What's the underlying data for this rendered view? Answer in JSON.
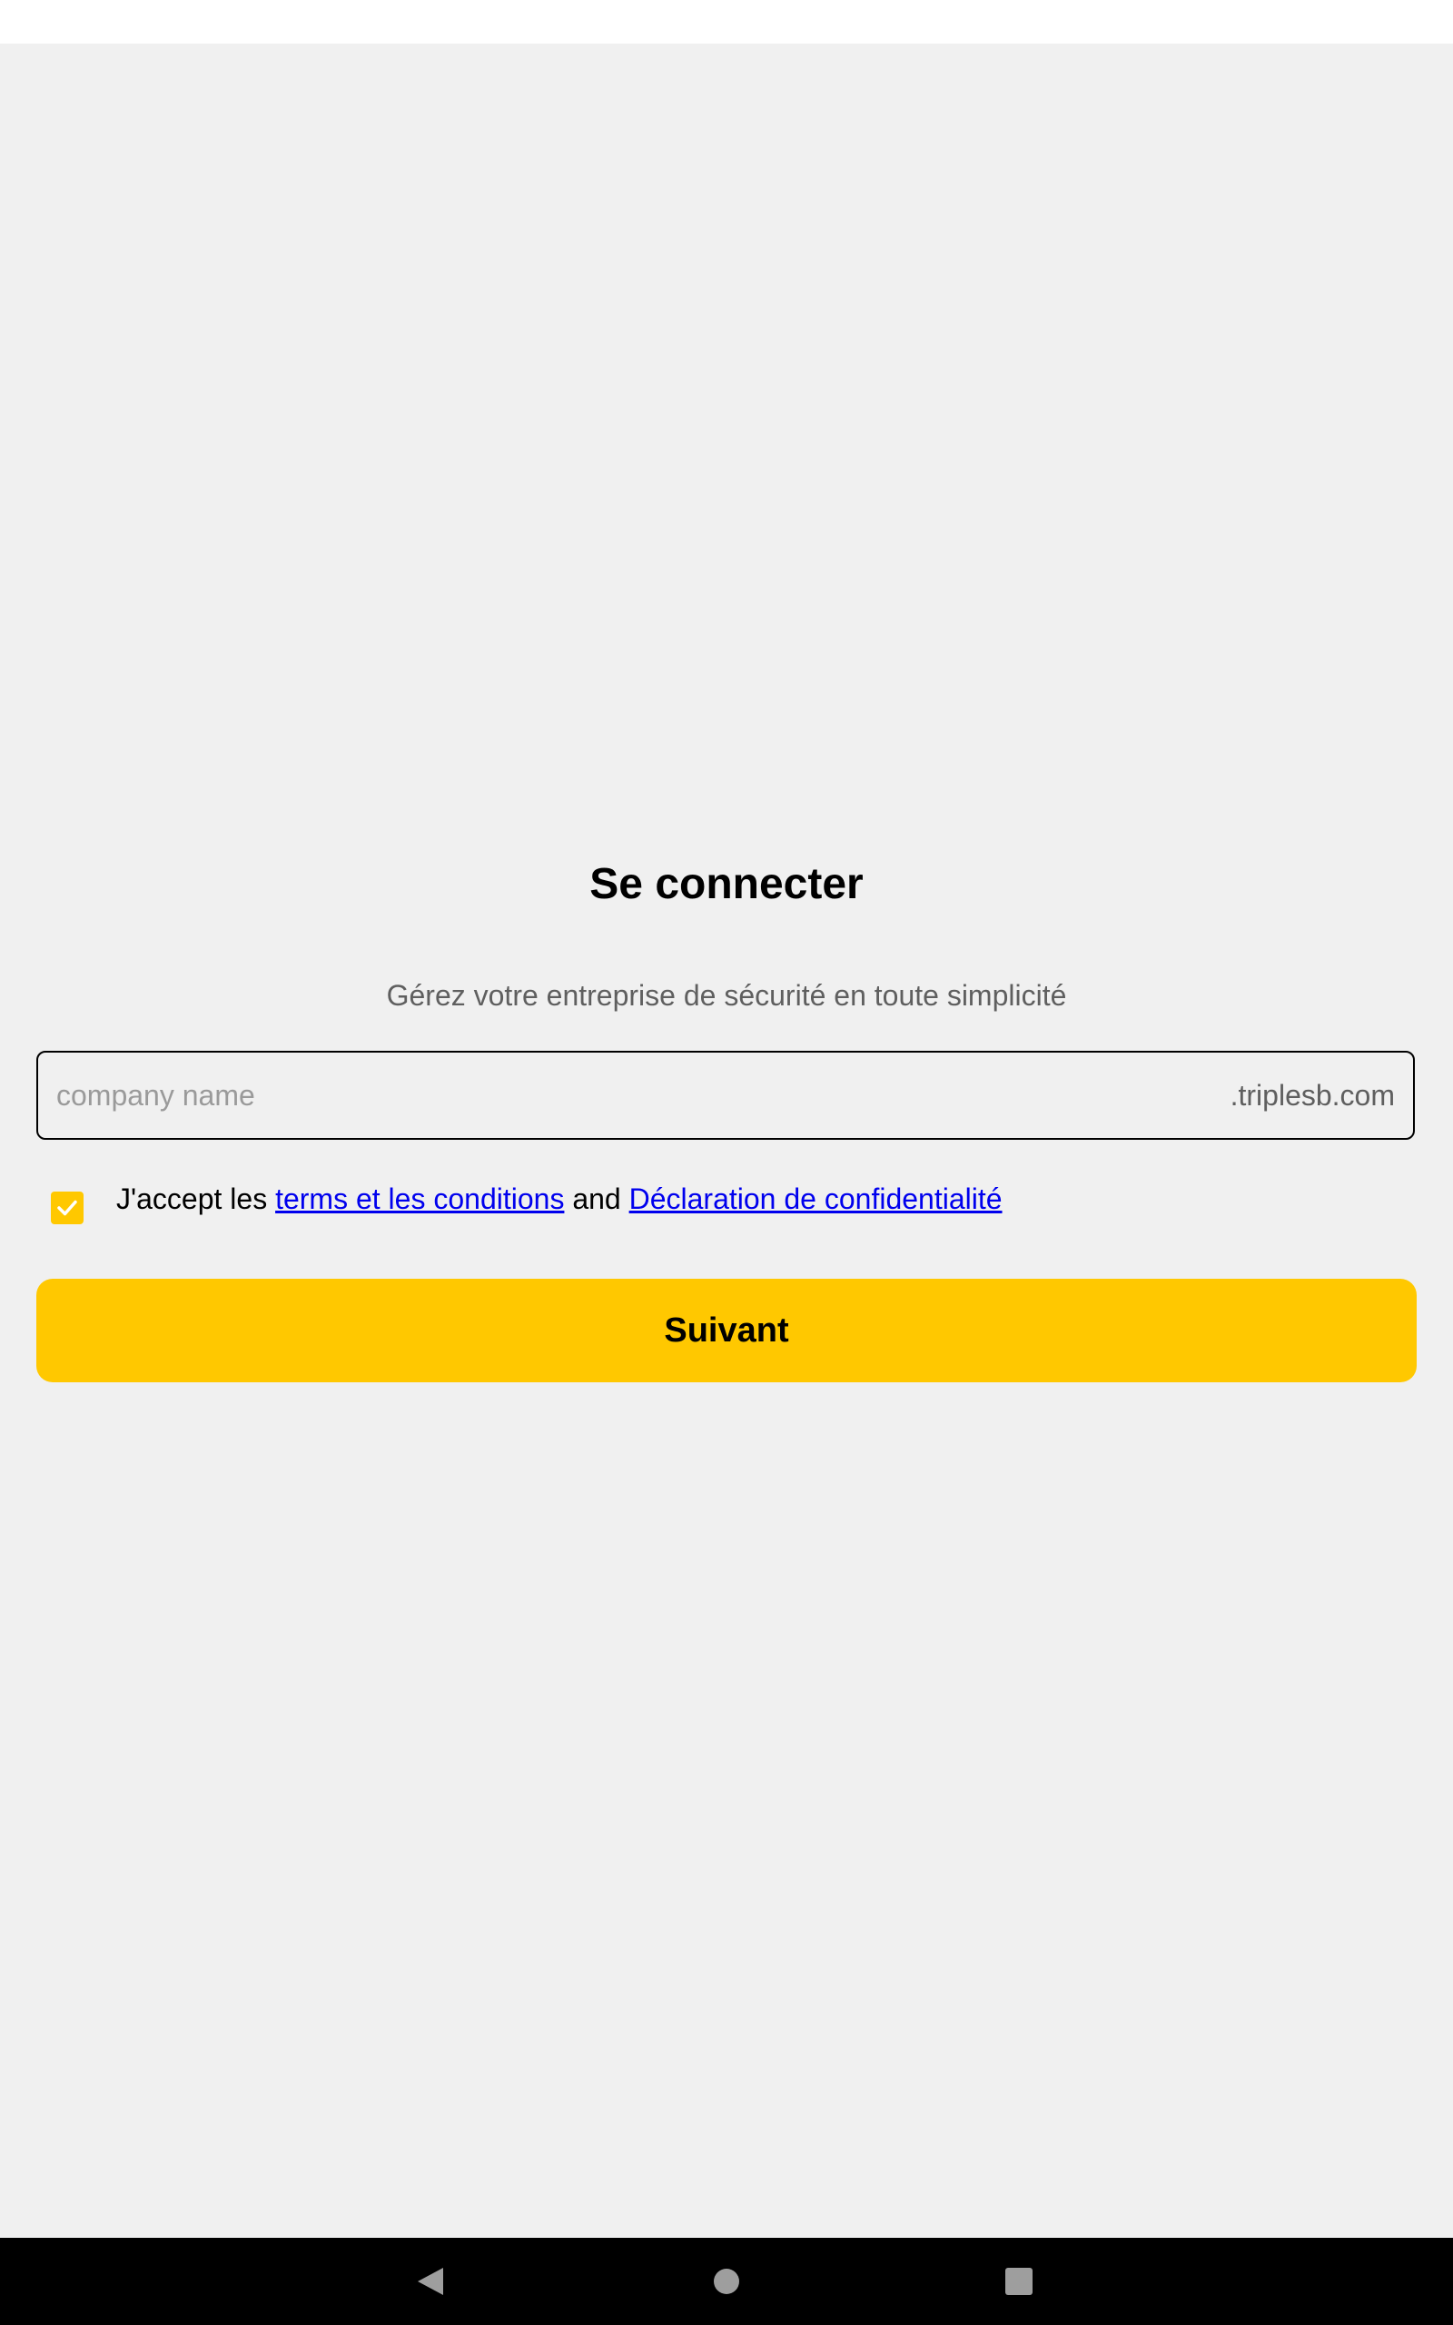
{
  "login": {
    "title": "Se connecter",
    "subtitle": "Gérez votre entreprise de sécurité en toute simplicité",
    "company_field": {
      "placeholder": "company name",
      "value": "",
      "suffix": ".triplesb.com"
    },
    "terms": {
      "checked": true,
      "prefix": "J'accept les ",
      "terms_link": "terms et les conditions",
      "conjunction": " and ",
      "privacy_link": "Déclaration de confidentialité"
    },
    "next_button_label": "Suivant"
  },
  "navigation_bar": {
    "back_icon": "back-triangle-icon",
    "home_icon": "home-circle-icon",
    "recents_icon": "recents-square-icon"
  },
  "colors": {
    "accent": "#ffc800",
    "background": "#f0f0f0",
    "link": "#0000ee"
  }
}
